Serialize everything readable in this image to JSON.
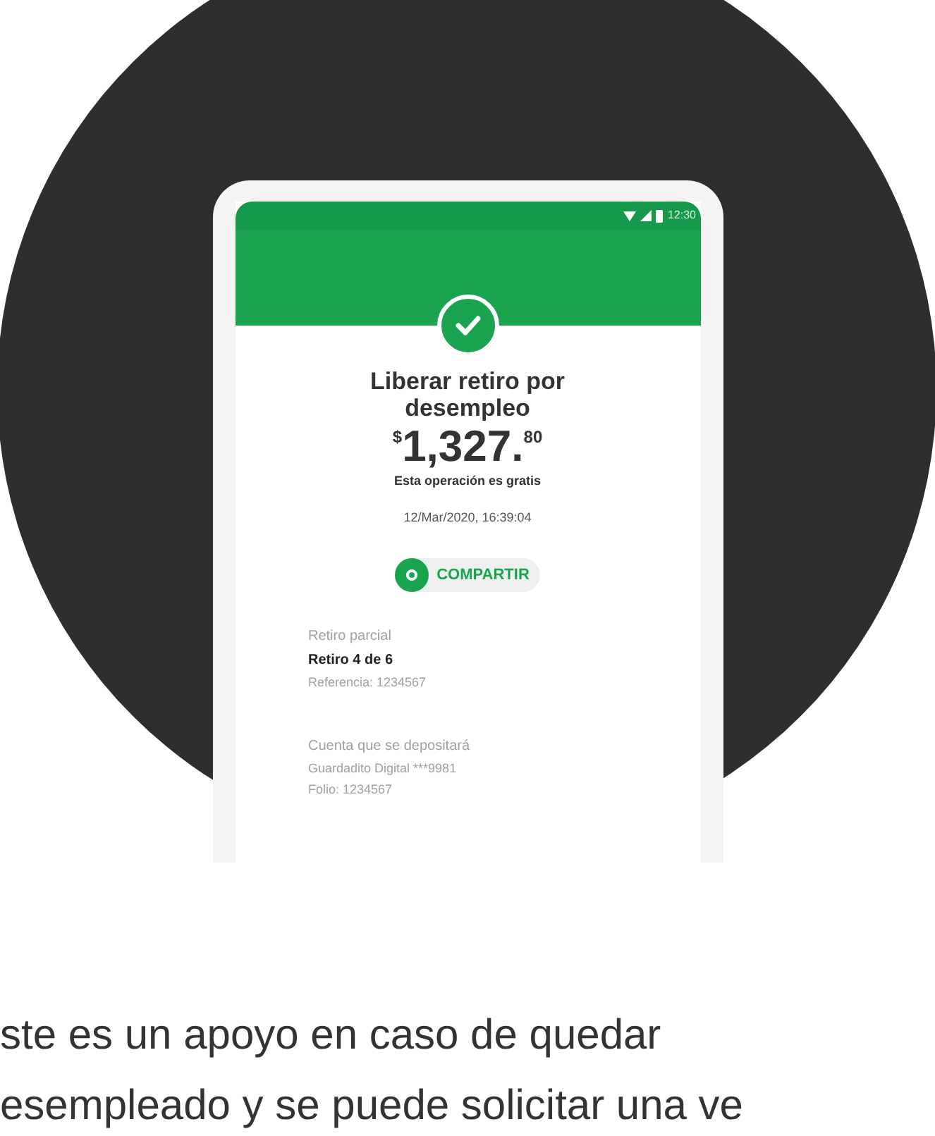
{
  "phone": {
    "status_bar": {
      "time": "12:30"
    },
    "title": "Liberar retiro por desempleo",
    "amount": {
      "currency": "$",
      "whole": "1,327.",
      "cents": "80"
    },
    "fee_note": "Esta operación es gratis",
    "datetime": "12/Mar/2020, 16:39:04",
    "share_button": "COMPARTIR",
    "details": [
      {
        "label": "Retiro parcial",
        "value": "Retiro 4 de 6",
        "extra": [
          "Referencia: 1234567"
        ]
      },
      {
        "label": "Cuenta que se depositará",
        "extra": [
          "Guardadito Digital ***9981",
          "Folio: 1234567"
        ]
      }
    ]
  },
  "description_lines": [
    "ste es un apoyo en caso de quedar",
    "esempleado y se puede solicitar una ve"
  ]
}
